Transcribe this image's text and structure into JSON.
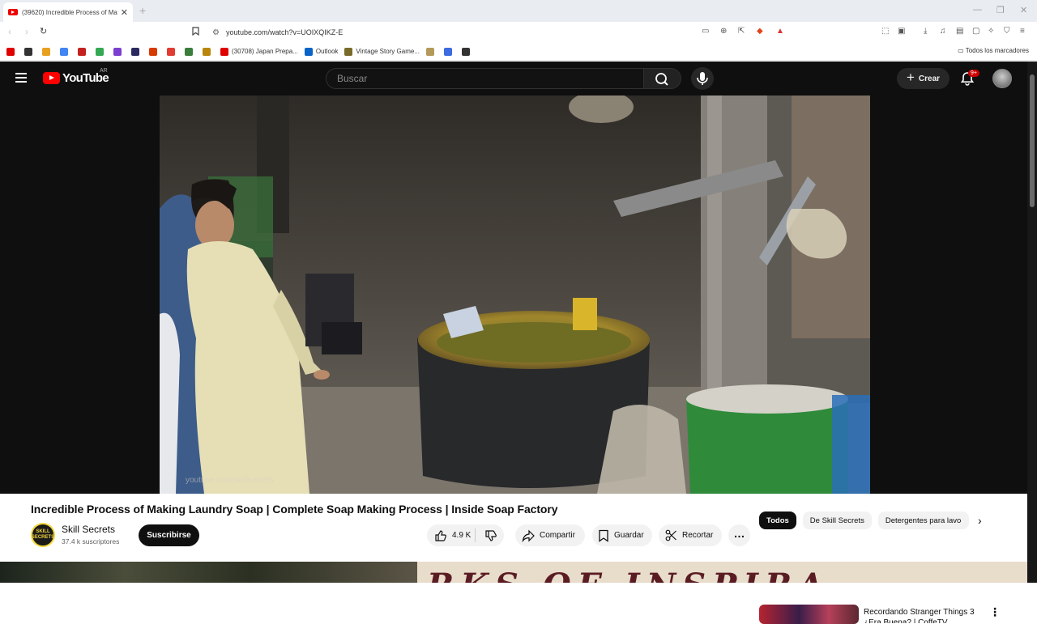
{
  "browser": {
    "tab_title": "(39620) Incredible Process of Ma",
    "url": "youtube.com/watch?v=UOIXQIKZ-E",
    "bookmarks": [
      {
        "label": "",
        "color": "#e00000"
      },
      {
        "label": "",
        "color": "#333333"
      },
      {
        "label": "",
        "color": "#e8a020"
      },
      {
        "label": "",
        "color": "#4285f4"
      },
      {
        "label": "",
        "color": "#c5221f"
      },
      {
        "label": "",
        "color": "#34a853"
      },
      {
        "label": "",
        "color": "#7b3fd1"
      },
      {
        "label": "",
        "color": "#2a2a60"
      },
      {
        "label": "",
        "color": "#d83b01"
      },
      {
        "label": "",
        "color": "#e03c31"
      },
      {
        "label": "",
        "color": "#3b7d3b"
      },
      {
        "label": "",
        "color": "#b8860b"
      },
      {
        "label": "(30708) Japan Prepa...",
        "color": "#e00000"
      },
      {
        "label": "Outlook",
        "color": "#0a64c8"
      },
      {
        "label": "Vintage Story Game...",
        "color": "#7a6a2a"
      },
      {
        "label": "",
        "color": "#b39a5a"
      },
      {
        "label": "",
        "color": "#3d6be0"
      },
      {
        "label": "",
        "color": "#333333"
      }
    ],
    "all_bookmarks_label": "Todos los marcadores"
  },
  "youtube": {
    "logo_text": "YouTube",
    "region": "AR",
    "search_placeholder": "Buscar",
    "create_label": "Crear",
    "notifications_badge": "9+"
  },
  "video": {
    "watermark": "youtube.com/skillsecrets",
    "title": "Incredible Process of Making Laundry Soap | Complete Soap Making Process | Inside Soap Factory",
    "channel_name": "Skill Secrets",
    "channel_avatar_text": "SKILL SECRETS",
    "subscribers": "37.4 k suscriptores",
    "subscribe_label": "Suscribirse",
    "likes": "4.9 K",
    "share_label": "Compartir",
    "save_label": "Guardar",
    "clip_label": "Recortar"
  },
  "sidebar": {
    "chips": [
      "Todos",
      "De Skill Secrets",
      "Detergentes para lavo"
    ],
    "rec_title": "Recordando Stranger Things 3 ¿Era Buena? | CoffeTV"
  },
  "bottom_strip_text": "RKS OF INSPIRA"
}
